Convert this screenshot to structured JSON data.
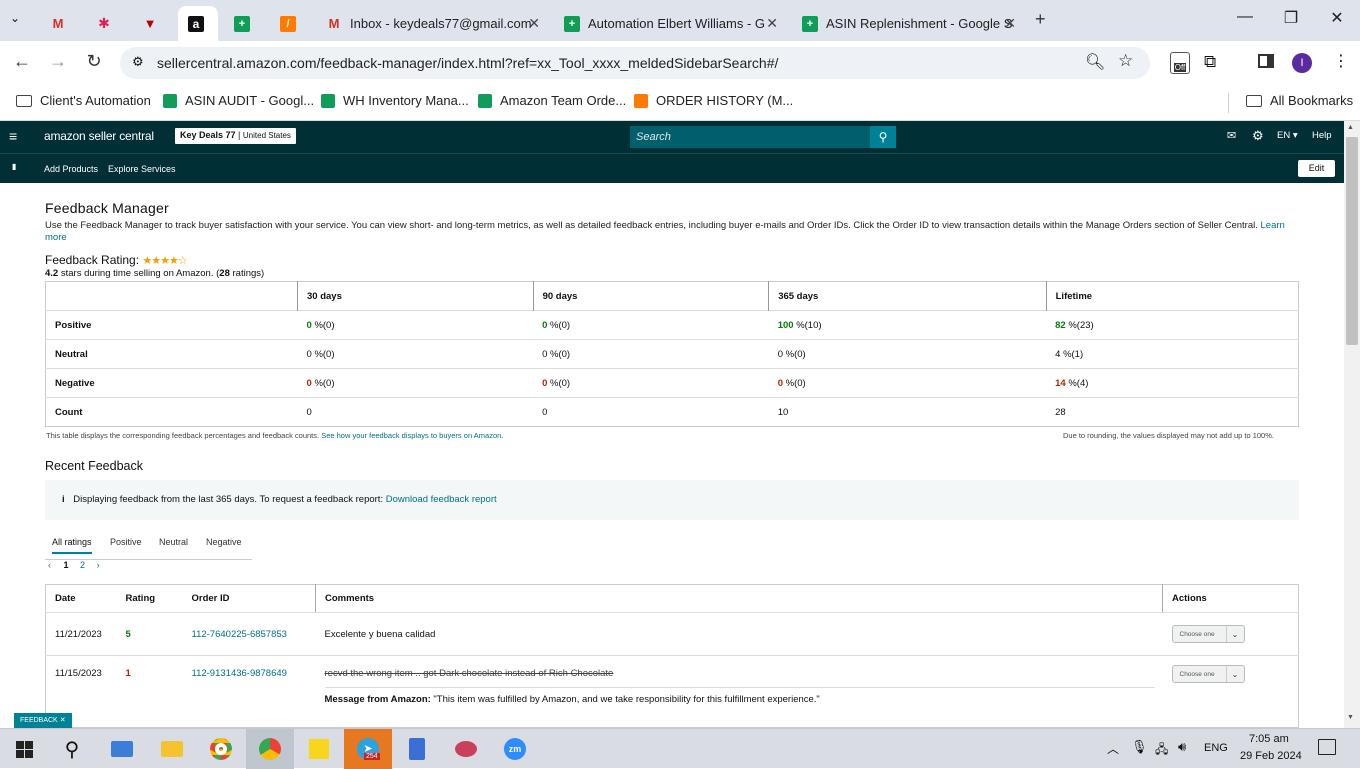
{
  "browser": {
    "tabs": [
      {
        "label": "",
        "icon": "gmail-icon"
      },
      {
        "label": "",
        "icon": "slack-icon"
      },
      {
        "label": "",
        "icon": "vpn-icon"
      },
      {
        "label": "",
        "icon": "amazon-icon"
      },
      {
        "label": "",
        "icon": "sheets-icon"
      },
      {
        "label": "",
        "icon": "zapier-icon"
      },
      {
        "label": "Inbox - keydeals77@gmail.com",
        "icon": "gmail-icon"
      },
      {
        "label": "Automation Elbert Williams - G",
        "icon": "sheets-icon"
      },
      {
        "label": "ASIN Replenishment - Google S",
        "icon": "sheets-icon"
      }
    ],
    "url": "sellercentral.amazon.com/feedback-manager/index.html?ref=xx_Tool_xxxx_meldedSidebarSearch#/",
    "extension_badge": "Off",
    "profile_initial": "I",
    "bookmarks": [
      "Client's Automation",
      "ASIN AUDIT - Googl...",
      "WH Inventory Mana...",
      "Amazon Team Orde...",
      "ORDER HISTORY (M..."
    ],
    "all_bookmarks": "All Bookmarks"
  },
  "header": {
    "logo": "amazon seller central",
    "account": "Key Deals 77",
    "marketplace": "United States",
    "search_placeholder": "Search",
    "language": "EN",
    "help": "Help",
    "nav": [
      "Add Products",
      "Explore Services"
    ],
    "edit": "Edit"
  },
  "page": {
    "title": "Feedback Manager",
    "description": "Use the Feedback Manager to track buyer satisfaction with your service. You can view short- and long-term metrics, as well as detailed feedback entries, including buyer e-mails and Order IDs. Click the Order ID to view transaction details within the Manage Orders section of Seller Central.",
    "learn_more": "Learn more",
    "rating_label": "Feedback Rating:",
    "rating_stars": 4.2,
    "rating_value": "4.2",
    "rating_text": "stars during time selling on Amazon.",
    "rating_count": "28",
    "rating_count_suffix": "ratings",
    "columns": [
      "30 days",
      "90 days",
      "365 days",
      "Lifetime"
    ],
    "rows": [
      {
        "label": "Positive",
        "values": [
          [
            "0",
            "%(0)"
          ],
          [
            "0",
            "%(0)"
          ],
          [
            "100",
            "%(10)"
          ],
          [
            "82",
            "%(23)"
          ]
        ]
      },
      {
        "label": "Neutral",
        "values": [
          [
            "0",
            "%(0)"
          ],
          [
            "0",
            "%(0)"
          ],
          [
            "0",
            "%(0)"
          ],
          [
            "4",
            "%(1)"
          ]
        ]
      },
      {
        "label": "Negative",
        "values": [
          [
            "0",
            "%(0)"
          ],
          [
            "0",
            "%(0)"
          ],
          [
            "0",
            "%(0)"
          ],
          [
            "14",
            "%(4)"
          ]
        ]
      },
      {
        "label": "Count",
        "values": [
          [
            "0",
            ""
          ],
          [
            "0",
            ""
          ],
          [
            "10",
            ""
          ],
          [
            "28",
            ""
          ]
        ]
      }
    ],
    "note_left": "This table displays the corresponding feedback percentages and feedback counts.",
    "note_link": "See how your feedback displays to buyers on Amazon.",
    "note_right": "Due to rounding, the values displayed may not add up to 100%.",
    "recent_title": "Recent Feedback",
    "info": "Displaying feedback from the last 365 days. To request a feedback report:",
    "info_link": "Download feedback report",
    "filter_tabs": [
      "All ratings",
      "Positive",
      "Neutral",
      "Negative"
    ],
    "pages": [
      "1",
      "2"
    ],
    "feedback_columns": [
      "Date",
      "Rating",
      "Order ID",
      "Comments",
      "Actions"
    ],
    "feedback": [
      {
        "date": "11/21/2023",
        "rating": "5",
        "order": "112-7640225-6857853",
        "comment": "Excelente y buena calidad",
        "action": "Choose one"
      },
      {
        "date": "11/15/2023",
        "rating": "1",
        "order": "112-9131436-9878649",
        "comment": "recvd the wrong item .. got Dark chocolate instead of Rich Chocolate",
        "message_label": "Message from Amazon:",
        "message": "\"This item was fulfilled by Amazon, and we take responsibility for this fulfillment experience.\"",
        "action": "Choose one"
      }
    ],
    "feedback_tag": "FEEDBACK"
  },
  "taskbar": {
    "telegram_badge": "254",
    "language": "ENG",
    "time": "7:05 am",
    "date": "29 Feb 2024"
  }
}
